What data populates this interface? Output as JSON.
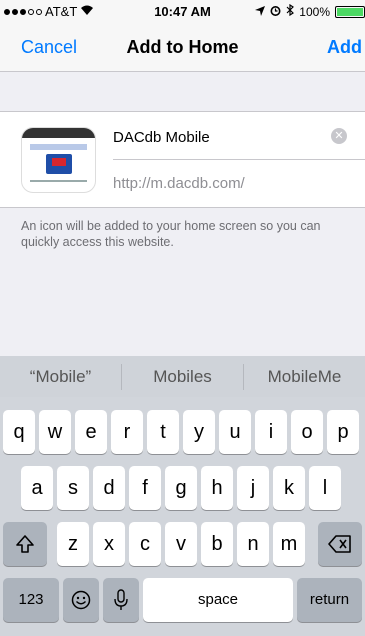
{
  "status_bar": {
    "carrier": "AT&T",
    "time": "10:47 AM",
    "battery": "100%",
    "battery_level": 1.0,
    "wifi_icon": "wifi-icon",
    "location_icon": "location-icon",
    "alarm_icon": "alarm-icon",
    "bluetooth_icon": "bluetooth-icon"
  },
  "nav": {
    "cancel_label": "Cancel",
    "title": "Add to Home",
    "add_label": "Add"
  },
  "bookmark": {
    "name_value": "DACdb Mobile",
    "url": "http://m.dacdb.com/"
  },
  "hint": "An icon will be added to your home screen so you can quickly access this website.",
  "keyboard": {
    "suggestions": [
      "“Mobile”",
      "Mobiles",
      "MobileMe"
    ],
    "row1": [
      "q",
      "w",
      "e",
      "r",
      "t",
      "y",
      "u",
      "i",
      "o",
      "p"
    ],
    "row2": [
      "a",
      "s",
      "d",
      "f",
      "g",
      "h",
      "j",
      "k",
      "l"
    ],
    "row3": [
      "z",
      "x",
      "c",
      "v",
      "b",
      "n",
      "m"
    ],
    "numbers_label": "123",
    "space_label": "space",
    "return_label": "return"
  },
  "colors": {
    "accent": "#007aff",
    "battery": "#4cd964"
  }
}
